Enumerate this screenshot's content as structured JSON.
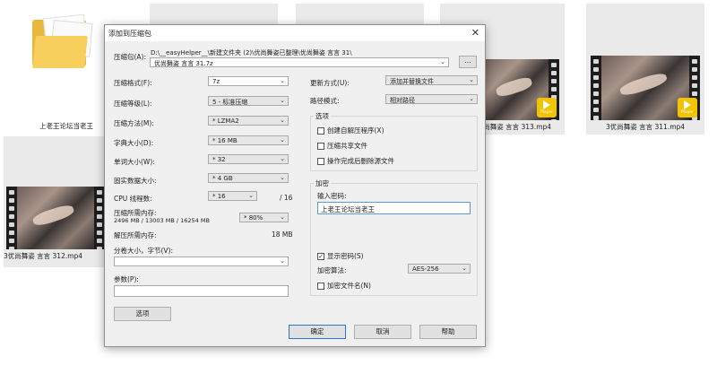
{
  "background": {
    "folder_caption": "上老王论坛当老王",
    "video_1_caption": "3优尚舞姿 言言 313.mp4",
    "video_2_caption": "3优尚舞姿 言言 311.mp4",
    "video_3_caption": "3优尚舞姿 言言 312.mp4",
    "player_badge": "Player"
  },
  "dialog": {
    "title": "添加到压缩包",
    "close_glyph": "✕",
    "archive_label": "压缩包(A):",
    "archive_path": "D:\\__easyHelper__\\新建文件夹 (2)\\优尚舞姿已整理\\优尚舞姿 言言 31\\",
    "archive_name": "优尚舞姿 言言 31.7z",
    "browse_label": "...",
    "format_label": "压缩格式(F):",
    "format_value": "7z",
    "level_label": "压缩等级(L):",
    "level_value": "5 - 标准压缩",
    "method_label": "压缩方法(M):",
    "method_value": "* LZMA2",
    "dict_label": "字典大小(D):",
    "dict_value": "* 16 MB",
    "word_label": "单词大小(W):",
    "word_value": "* 32",
    "solid_label": "固实数据大小:",
    "solid_value": "* 4 GB",
    "threads_label": "CPU 线程数:",
    "threads_value": "* 16",
    "threads_total": "/ 16",
    "mem_comp_label": "压缩所需内存:",
    "mem_comp_value": "2496 MB / 13003 MB / 16254 MB",
    "mem_pct_value": "* 80%",
    "mem_decomp_label": "解压所需内存:",
    "mem_decomp_value": "18 MB",
    "split_label": "分卷大小，字节(V):",
    "split_value": "",
    "params_label": "参数(P):",
    "params_value": "",
    "options_button": "选项",
    "update_label": "更新方式(U):",
    "update_value": "添加并替换文件",
    "path_label": "路径模式:",
    "path_value": "相对路径",
    "options_group": "选项",
    "opt_sfx": "创建自解压程序(X)",
    "opt_shared": "压缩共享文件",
    "opt_delete": "操作完成后删除源文件",
    "encrypt_group": "加密",
    "password_label": "输入密码:",
    "password_value": "上老王论坛当老王",
    "show_password": "显示密码(S)",
    "enc_method_label": "加密算法:",
    "enc_method_value": "AES-256",
    "enc_names": "加密文件名(N)",
    "ok": "确定",
    "cancel": "取消",
    "help": "帮助",
    "dropdown_glyph": "⌄",
    "check_glyph": "✓"
  },
  "state": {
    "opt_sfx_checked": false,
    "opt_shared_checked": false,
    "opt_delete_checked": false,
    "show_password_checked": true,
    "enc_names_checked": false
  }
}
